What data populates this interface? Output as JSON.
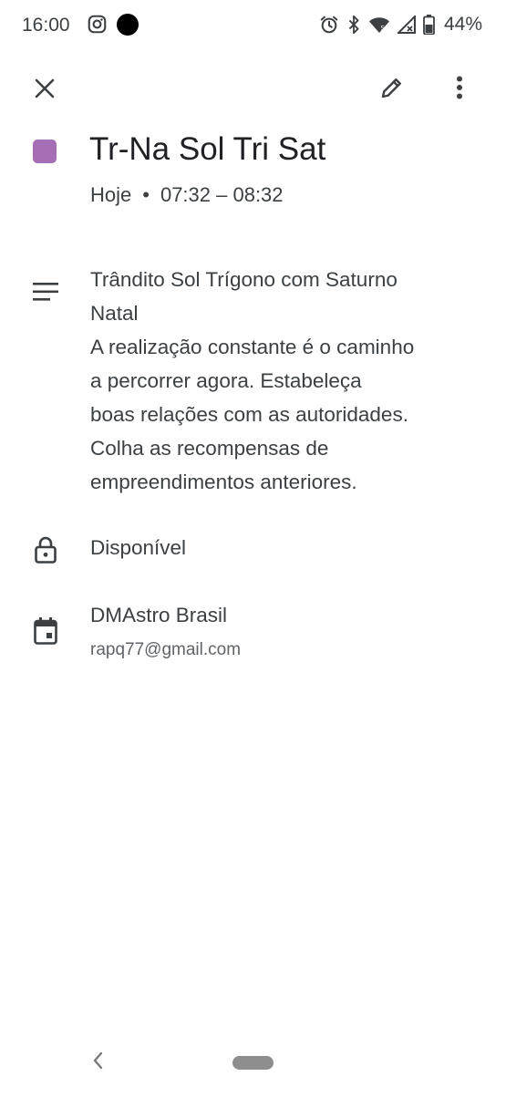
{
  "status_bar": {
    "time": "16:00",
    "battery": "44%",
    "icons": [
      "instagram-icon",
      "notification-dot-icon",
      "alarm-icon",
      "bluetooth-icon",
      "wifi-icon",
      "signal-icon",
      "battery-icon"
    ]
  },
  "toolbar": {
    "icons": [
      "close-icon",
      "edit-icon",
      "more-vert-icon"
    ]
  },
  "event": {
    "color": "#a66fb5",
    "title": "Tr-Na Sol Tri Sat",
    "day": "Hoje",
    "separator": "•",
    "time_range": "07:32 – 08:32"
  },
  "description": {
    "icon": "notes-icon",
    "lines": [
      "Trândito Sol Trígono com Saturno",
      "Natal",
      "A realização constante é o caminho",
      "a percorrer agora. Estabeleça",
      "boas relações com as autoridades.",
      "Colha as recompensas de",
      "empreendimentos anteriores."
    ]
  },
  "availability": {
    "icon": "lock-icon",
    "label": "Disponível"
  },
  "calendar": {
    "icon": "calendar-icon",
    "name": "DMAstro Brasil",
    "account": "rapq77@gmail.com"
  },
  "nav": {
    "icons": [
      "back-chevron-icon",
      "home-pill"
    ]
  }
}
